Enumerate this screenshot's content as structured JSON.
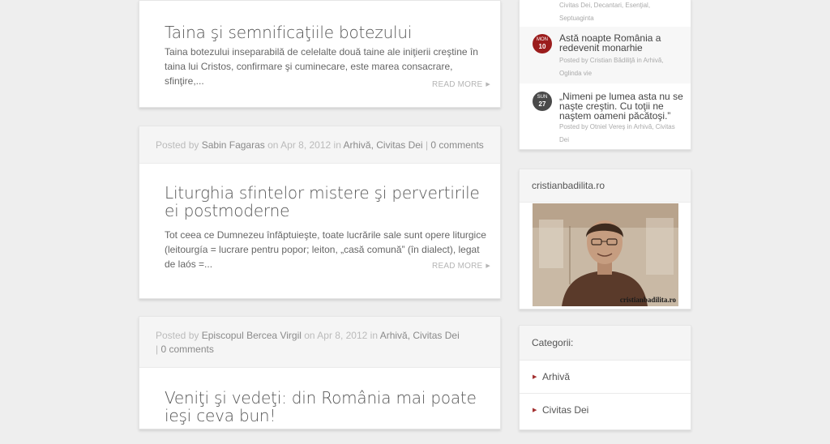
{
  "posts": [
    {
      "title": "Taina şi semnificaţiile botezului",
      "excerpt": "Taina botezului inseparabilă de celelalte două taine ale iniţierii creştine în taina lui Cristos, confirmare şi cuminecare, este marea consacrare, sfinţire,...",
      "read_more": "READ MORE"
    },
    {
      "meta": {
        "posted_by": "Posted by",
        "author": "Sabin Fagaras",
        "on": "on",
        "date": "Apr 8, 2012",
        "in": "in",
        "cat1": "Arhivă",
        "sep": ",",
        "cat2": "Civitas Dei",
        "pipe": "|",
        "comments": "0 comments"
      },
      "title": "Liturghia sfintelor mistere şi pervertirile ei postmoderne",
      "excerpt": "Tot ceea ce Dumnezeu înfăptuieşte, toate lucrările sale sunt opere liturgice (leitourgía = lucrare pentru popor; leiton, „casă comună” (în dialect), legat de laós =...",
      "read_more": "READ MORE"
    },
    {
      "meta": {
        "posted_by": "Posted by",
        "author": "Episcopul Bercea Virgil",
        "on": "on",
        "date": "Apr 8, 2012",
        "in": "in",
        "cat1": "Arhivă",
        "sep": ",",
        "cat2": "Civitas Dei",
        "pipe": "|",
        "comments": "0 comments"
      },
      "title": "Veniţi şi vedeţi: din România mai poate ieşi ceva bun!"
    }
  ],
  "recent_posts": {
    "top_meta": "Civitas Dei, Decantari, Esenţial,",
    "top_meta2": "Septuaginta",
    "items": [
      {
        "month": "MON",
        "day": "10",
        "title": "Astă noapte România a redevenit monarhie",
        "meta1": "Posted by Cristian Bădiliţă in Arhivă,",
        "meta2": "Oglinda vie",
        "badge_color": "#9b1c1c"
      },
      {
        "month": "SUN",
        "day": "27",
        "title": "„Nimeni pe lumea asta nu se naşte creştin. Cu toţii ne naştem oameni păcătoşi.”",
        "meta1": "Posted by Otniel Vereş in Arhivă, Civitas",
        "meta2": "Dei",
        "badge_color": "#4a4a4a"
      }
    ]
  },
  "photo_widget": {
    "title": "cristianbadilita.ro",
    "caption": "cristianbadilita.ro"
  },
  "categories": {
    "title": "Categorii:",
    "items": [
      "Arhivă",
      "Civitas Dei"
    ]
  }
}
